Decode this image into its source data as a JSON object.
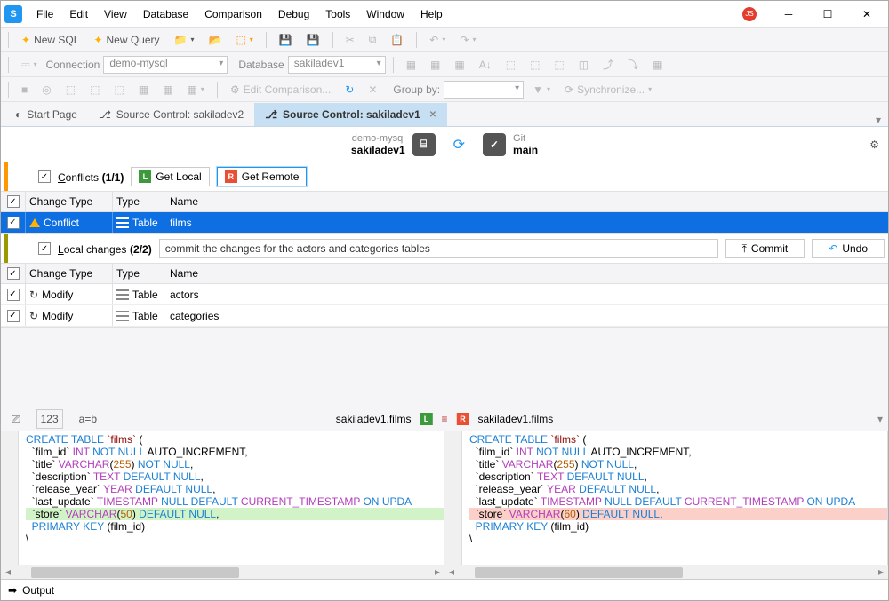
{
  "menu": {
    "file": "File",
    "edit": "Edit",
    "view": "View",
    "database": "Database",
    "comparison": "Comparison",
    "debug": "Debug",
    "tools": "Tools",
    "window": "Window",
    "help": "Help"
  },
  "user_badge": "JS",
  "toolbar1": {
    "new_sql": "New SQL",
    "new_query": "New Query"
  },
  "toolbar2": {
    "connection": "Connection",
    "conn_val": "demo-mysql",
    "database": "Database",
    "db_val": "sakiladev1"
  },
  "toolbar3": {
    "edit_comp": "Edit Comparison...",
    "group_by": "Group by:",
    "sync": "Synchronize..."
  },
  "tabs": {
    "start": "Start Page",
    "t1": "Source Control: sakiladev2",
    "t2": "Source Control: sakiladev1"
  },
  "sc": {
    "left_top": "demo-mysql",
    "left_bot": "sakiladev1",
    "right_top": "Git",
    "right_bot": "main"
  },
  "conflicts": {
    "title": "Conflicts",
    "count": "(1/1)",
    "get_local": "Get Local",
    "get_remote": "Get Remote",
    "headers": {
      "ct": "Change Type",
      "type": "Type",
      "name": "Name"
    },
    "row": {
      "ct": "Conflict",
      "type": "Table",
      "name": "films"
    }
  },
  "local": {
    "title": "Local changes",
    "count": "(2/2)",
    "commit_msg": "commit the changes for the actors and categories tables",
    "commit": "Commit",
    "undo": "Undo",
    "headers": {
      "ct": "Change Type",
      "type": "Type",
      "name": "Name"
    },
    "rows": [
      {
        "ct": "Modify",
        "type": "Table",
        "name": "actors"
      },
      {
        "ct": "Modify",
        "type": "Table",
        "name": "categories"
      }
    ]
  },
  "diff": {
    "opt_ab": "a=b",
    "opt_123": "123",
    "left_name": "sakiladev1.films",
    "right_name": "sakiladev1.films"
  },
  "code_left": {
    "l1a": "CREATE",
    "l1b": " TABLE",
    "l1c": " `films`",
    "l1d": " (",
    "l2a": "  `film_id` ",
    "l2b": "INT",
    "l2c": " NOT",
    "l2d": " NULL",
    "l2e": " AUTO_INCREMENT,",
    "l3a": "  `title` ",
    "l3b": "VARCHAR",
    "l3c": "(",
    "l3d": "255",
    "l3e": ") ",
    "l3f": "NOT",
    "l3g": " NULL",
    "l3h": ",",
    "l4a": "  `description` ",
    "l4b": "TEXT",
    "l4c": " DEFAULT",
    "l4d": " NULL",
    "l4e": ",",
    "l5a": "  `release_year` ",
    "l5b": "YEAR",
    "l5c": " DEFAULT",
    "l5d": " NULL",
    "l5e": ",",
    "l6a": "  `last_update` ",
    "l6b": "TIMESTAMP",
    "l6c": " NULL",
    "l6d": " DEFAULT",
    "l6e": " CURRENT_TIMESTAMP",
    "l6f": " ON",
    "l6g": " UPDA",
    "l7a": "  `store` ",
    "l7b": "VARCHAR",
    "l7c": "(",
    "l7d": "50",
    "l7e": ") ",
    "l7f": "DEFAULT",
    "l7g": " NULL",
    "l7h": ",",
    "l8a": "  PRIMARY",
    "l8b": " KEY",
    "l8c": " (film_id)",
    "l9": "\\"
  },
  "code_right": {
    "l7d": "60"
  },
  "output": "Output"
}
